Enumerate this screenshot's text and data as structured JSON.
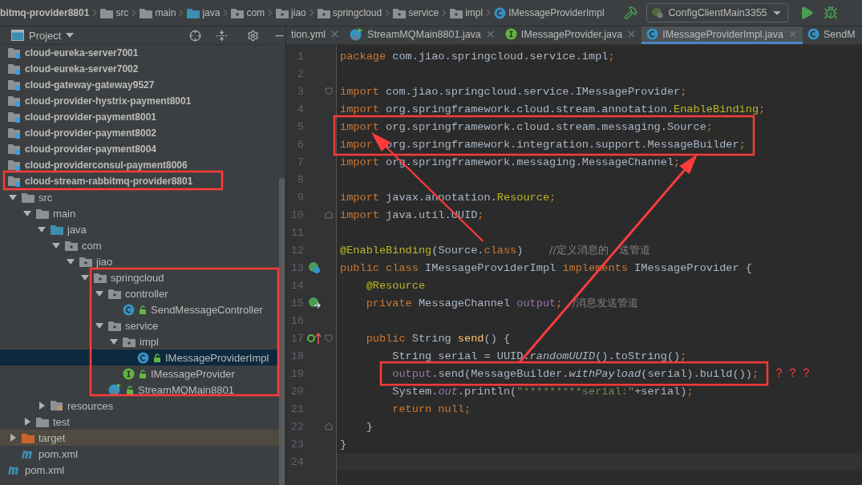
{
  "breadcrumbs": [
    {
      "label": "bitmq-provider8801",
      "kind": "module"
    },
    {
      "label": "src",
      "kind": "folder"
    },
    {
      "label": "main",
      "kind": "folder"
    },
    {
      "label": "java",
      "kind": "source-folder"
    },
    {
      "label": "com",
      "kind": "package"
    },
    {
      "label": "jiao",
      "kind": "package"
    },
    {
      "label": "springcloud",
      "kind": "package"
    },
    {
      "label": "service",
      "kind": "package"
    },
    {
      "label": "impl",
      "kind": "package"
    },
    {
      "label": "IMessageProviderImpl",
      "kind": "class"
    }
  ],
  "run_config": {
    "label": "ConfigClientMain3355"
  },
  "project_panel": {
    "title": "Project"
  },
  "tabs": [
    {
      "label": "tion.yml",
      "kind": "yaml",
      "selected": false
    },
    {
      "label": "StreamMQMain8801.java",
      "kind": "main-class",
      "selected": false
    },
    {
      "label": "IMessageProvider.java",
      "kind": "interface",
      "selected": false
    },
    {
      "label": "IMessageProviderImpl.java",
      "kind": "class",
      "selected": true
    },
    {
      "label": "SendM",
      "kind": "class",
      "selected": false
    }
  ],
  "tree": [
    {
      "label": "cloud-eureka-server7001",
      "kind": "module",
      "selected": false
    },
    {
      "label": "cloud-eureka-server7002",
      "kind": "module",
      "selected": false
    },
    {
      "label": "cloud-gateway-gateway9527",
      "kind": "module",
      "selected": false
    },
    {
      "label": "cloud-provider-hystrix-payment8001",
      "kind": "module",
      "selected": false
    },
    {
      "label": "cloud-provider-payment8001",
      "kind": "module",
      "selected": false
    },
    {
      "label": "cloud-provider-payment8002",
      "kind": "module",
      "selected": false
    },
    {
      "label": "cloud-provider-payment8004",
      "kind": "module",
      "selected": false
    },
    {
      "label": "cloud-providerconsul-payment8006",
      "kind": "module",
      "selected": false
    },
    {
      "label": "cloud-stream-rabbitmq-provider8801",
      "kind": "module",
      "selected": false,
      "children": [
        {
          "label": "src",
          "kind": "folder",
          "expanded": true,
          "selected": false,
          "children": [
            {
              "label": "main",
              "kind": "folder",
              "expanded": true,
              "selected": false,
              "children": [
                {
                  "label": "java",
                  "kind": "source-folder",
                  "expanded": true,
                  "selected": false,
                  "children": [
                    {
                      "label": "com",
                      "kind": "package",
                      "expanded": true,
                      "selected": false,
                      "children": [
                        {
                          "label": "jiao",
                          "kind": "package",
                          "expanded": true,
                          "selected": false,
                          "children": [
                            {
                              "label": "springcloud",
                              "kind": "package",
                              "expanded": true,
                              "selected": false,
                              "children": [
                                {
                                  "label": "controller",
                                  "kind": "package",
                                  "expanded": true,
                                  "selected": false,
                                  "children": [
                                    {
                                      "label": "SendMessageController",
                                      "kind": "class",
                                      "selected": false
                                    }
                                  ]
                                },
                                {
                                  "label": "service",
                                  "kind": "package",
                                  "expanded": true,
                                  "selected": false,
                                  "children": [
                                    {
                                      "label": "impl",
                                      "kind": "package",
                                      "expanded": true,
                                      "selected": false,
                                      "children": [
                                        {
                                          "label": "IMessageProviderImpl",
                                          "kind": "class",
                                          "selected": true
                                        }
                                      ]
                                    },
                                    {
                                      "label": "IMessageProvider",
                                      "kind": "interface",
                                      "selected": false
                                    }
                                  ]
                                },
                                {
                                  "label": "StreamMQMain8801",
                                  "kind": "main-class",
                                  "selected": false
                                }
                              ]
                            }
                          ]
                        }
                      ]
                    }
                  ]
                },
                {
                  "label": "resources",
                  "kind": "resources",
                  "expanded": false,
                  "selected": false
                }
              ]
            },
            {
              "label": "test",
              "kind": "folder",
              "expanded": false,
              "selected": false
            }
          ]
        },
        {
          "label": "target",
          "kind": "target",
          "expanded": false,
          "selected": false
        },
        {
          "label": "pom.xml",
          "kind": "maven",
          "selected": false
        }
      ]
    },
    {
      "label": "pom.xml",
      "kind": "maven",
      "selected": false
    }
  ],
  "code_lines": [
    {
      "num": "1",
      "current": false,
      "tokens": [
        {
          "kind": "keyword",
          "text": "package"
        },
        {
          "kind": "plain",
          "text": " com.jiao.springcloud.service.impl"
        },
        {
          "kind": "keyword",
          "text": ";"
        }
      ]
    },
    {
      "num": "2",
      "current": false
    },
    {
      "num": "3",
      "current": false,
      "fold_start": true,
      "tokens": [
        {
          "kind": "keyword",
          "text": "import"
        },
        {
          "kind": "plain",
          "text": " com.jiao.springcloud.service.IMessageProvider"
        },
        {
          "kind": "keyword",
          "text": ";"
        }
      ]
    },
    {
      "num": "4",
      "current": false,
      "tokens": [
        {
          "kind": "keyword",
          "text": "import"
        },
        {
          "kind": "plain",
          "text": " org.springframework.cloud.stream.annotation."
        },
        {
          "kind": "annotation",
          "text": "EnableBinding"
        },
        {
          "kind": "keyword",
          "text": ";"
        }
      ]
    },
    {
      "num": "5",
      "current": false,
      "tokens": [
        {
          "kind": "keyword",
          "text": "import"
        },
        {
          "kind": "plain",
          "text": " org.springframework.cloud.stream.messaging.Source"
        },
        {
          "kind": "keyword",
          "text": ";"
        }
      ]
    },
    {
      "num": "6",
      "current": false,
      "tokens": [
        {
          "kind": "keyword",
          "text": "impor"
        },
        {
          "kind": "plain",
          "text": "  org.springframework.integration.support.MessageBuilder"
        },
        {
          "kind": "keyword",
          "text": ";"
        }
      ]
    },
    {
      "num": "7",
      "current": false,
      "tokens": [
        {
          "kind": "keyword",
          "text": "import"
        },
        {
          "kind": "plain",
          "text": " org.springframework.messaging.MessageChannel"
        },
        {
          "kind": "keyword",
          "text": ";"
        }
      ]
    },
    {
      "num": "8",
      "current": false
    },
    {
      "num": "9",
      "current": false,
      "tokens": [
        {
          "kind": "keyword",
          "text": "import"
        },
        {
          "kind": "plain",
          "text": " javax.annotation."
        },
        {
          "kind": "annotation",
          "text": "Resource"
        },
        {
          "kind": "keyword",
          "text": ";"
        }
      ]
    },
    {
      "num": "10",
      "current": false,
      "fold_end": true,
      "tokens": [
        {
          "kind": "keyword",
          "text": "import"
        },
        {
          "kind": "plain",
          "text": " java.util.UUID"
        },
        {
          "kind": "keyword",
          "text": ";"
        }
      ]
    },
    {
      "num": "11",
      "current": false
    },
    {
      "num": "12",
      "current": false,
      "tokens": [
        {
          "kind": "annotation",
          "text": "@EnableBinding"
        },
        {
          "kind": "plain",
          "text": "(Source."
        },
        {
          "kind": "keyword",
          "text": "class"
        },
        {
          "kind": "plain",
          "text": ")    "
        },
        {
          "kind": "comment",
          "text": "//定义消息的　送管道"
        }
      ]
    },
    {
      "num": "13",
      "current": false,
      "implemented_marker": true,
      "tokens": [
        {
          "kind": "keyword",
          "text": "public class "
        },
        {
          "kind": "plain",
          "text": "IMessageProviderImpl "
        },
        {
          "kind": "keyword",
          "text": "implements "
        },
        {
          "kind": "plain",
          "text": "IMessageProvider {"
        }
      ]
    },
    {
      "num": "14",
      "current": false,
      "tokens": [
        {
          "kind": "annotation",
          "text": "    @Resource"
        }
      ]
    },
    {
      "num": "15",
      "current": false,
      "injection_marker": true,
      "tokens": [
        {
          "kind": "keyword",
          "text": "    private "
        },
        {
          "kind": "plain",
          "text": "MessageChannel "
        },
        {
          "kind": "field",
          "text": "output"
        },
        {
          "kind": "keyword",
          "text": ";"
        },
        {
          "kind": "comment",
          "text": "   /消息发送管道"
        }
      ]
    },
    {
      "num": "16",
      "current": false
    },
    {
      "num": "17",
      "current": false,
      "implements_marker": true,
      "fold_start": true,
      "tokens": [
        {
          "kind": "keyword",
          "text": "    public "
        },
        {
          "kind": "plain",
          "text": "String "
        },
        {
          "kind": "method",
          "text": "send"
        },
        {
          "kind": "plain",
          "text": "() {"
        }
      ]
    },
    {
      "num": "18",
      "current": false,
      "tokens": [
        {
          "kind": "plain",
          "text": "        String serial = UUID."
        },
        {
          "kind": "static-call",
          "text": "randomUUID"
        },
        {
          "kind": "plain",
          "text": "().toString()"
        },
        {
          "kind": "keyword",
          "text": ";"
        }
      ]
    },
    {
      "num": "19",
      "current": false,
      "tokens": [
        {
          "kind": "field",
          "text": "        output"
        },
        {
          "kind": "plain",
          "text": ".send(MessageBuilder."
        },
        {
          "kind": "static-call",
          "text": "withPayload"
        },
        {
          "kind": "plain",
          "text": "(serial).build())"
        },
        {
          "kind": "keyword",
          "text": ";"
        }
      ]
    },
    {
      "num": "20",
      "current": false,
      "tokens": [
        {
          "kind": "plain",
          "text": "        System."
        },
        {
          "kind": "static-field",
          "text": "out"
        },
        {
          "kind": "plain",
          "text": ".println("
        },
        {
          "kind": "string",
          "text": "\"*********serial:\""
        },
        {
          "kind": "plain",
          "text": "+serial)"
        },
        {
          "kind": "keyword",
          "text": ";"
        }
      ]
    },
    {
      "num": "21",
      "current": false,
      "tokens": [
        {
          "kind": "keyword",
          "text": "        return null;"
        }
      ]
    },
    {
      "num": "22",
      "current": false,
      "fold_end": true,
      "tokens": [
        {
          "kind": "plain",
          "text": "    }"
        }
      ]
    },
    {
      "num": "23",
      "current": false,
      "tokens": [
        {
          "kind": "plain",
          "text": "}"
        }
      ]
    },
    {
      "num": "24",
      "current": true
    }
  ],
  "annotation_note": "？？？"
}
